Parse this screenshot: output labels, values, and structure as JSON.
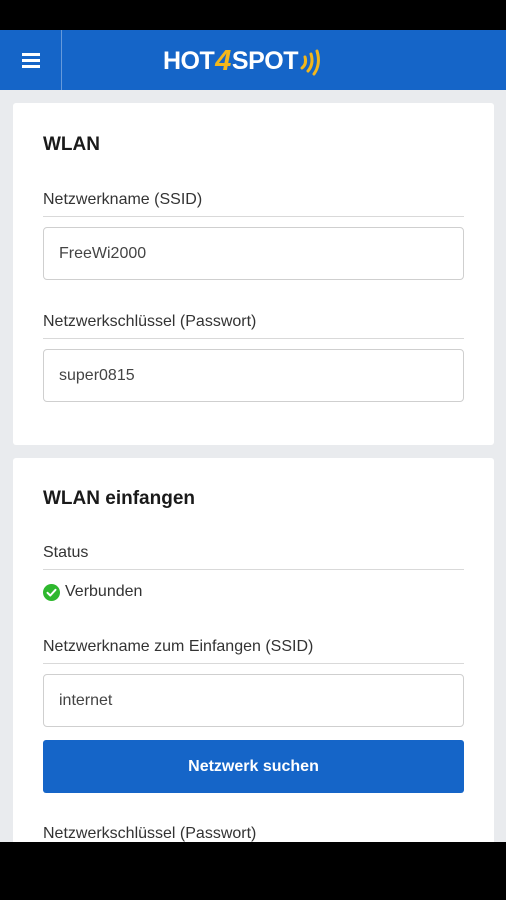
{
  "app": {
    "logo_prefix": "HOT",
    "logo_digit": "4",
    "logo_suffix": "SPOT",
    "brand_color": "#1565c8",
    "accent_color": "#f3b71b"
  },
  "wlan": {
    "title": "WLAN",
    "ssid_label": "Netzwerkname (SSID)",
    "ssid_value": "FreeWi2000",
    "password_label": "Netzwerkschlüssel (Passwort)",
    "password_value": "super0815"
  },
  "capture": {
    "title": "WLAN einfangen",
    "status_label": "Status",
    "status_value": "Verbunden",
    "status_color": "#2eb82e",
    "ssid_label": "Netzwerkname zum Einfangen (SSID)",
    "ssid_value": "internet",
    "search_button": "Netzwerk suchen",
    "password_label": "Netzwerkschlüssel (Passwort)"
  },
  "icons": {
    "menu": "hamburger-menu-icon",
    "status": "check-circle-icon",
    "logo_signal": "signal-waves-icon"
  }
}
